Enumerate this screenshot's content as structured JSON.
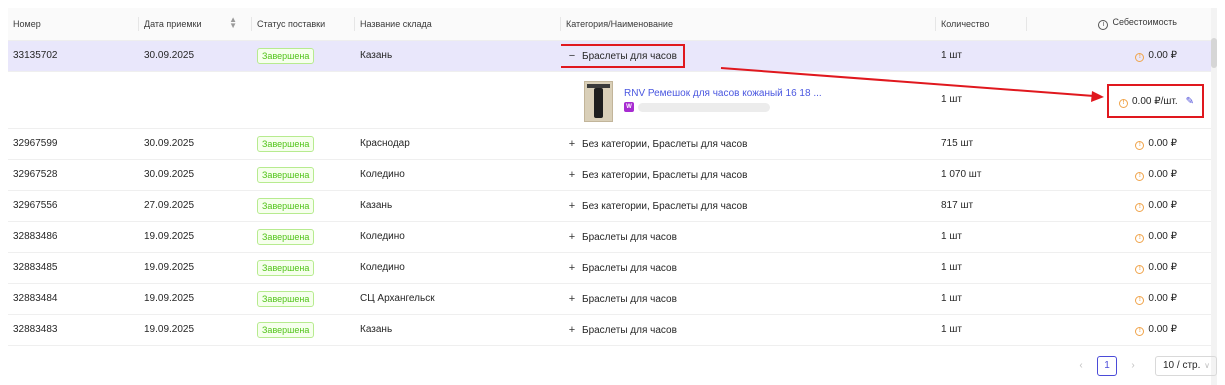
{
  "columns": {
    "number": "Номер",
    "date": "Дата приемки",
    "status": "Статус поставки",
    "warehouse": "Название склада",
    "category": "Категория/Наименование",
    "quantity": "Количество",
    "cost": "Себестоимость"
  },
  "rows": [
    {
      "number": "33135702",
      "date": "30.09.2025",
      "status": "Завершена",
      "warehouse": "Казань",
      "category": "Браслеты для часов",
      "quantity": "1 шт",
      "cost": "0.00 ₽",
      "expand": "−"
    },
    {
      "number": "32967599",
      "date": "30.09.2025",
      "status": "Завершена",
      "warehouse": "Краснодар",
      "category": "Без категории, Браслеты для часов",
      "quantity": "715 шт",
      "cost": "0.00 ₽",
      "expand": "+"
    },
    {
      "number": "32967528",
      "date": "30.09.2025",
      "status": "Завершена",
      "warehouse": "Коледино",
      "category": "Без категории, Браслеты для часов",
      "quantity": "1 070 шт",
      "cost": "0.00 ₽",
      "expand": "+"
    },
    {
      "number": "32967556",
      "date": "27.09.2025",
      "status": "Завершена",
      "warehouse": "Казань",
      "category": "Без категории, Браслеты для часов",
      "quantity": "817 шт",
      "cost": "0.00 ₽",
      "expand": "+"
    },
    {
      "number": "32883486",
      "date": "19.09.2025",
      "status": "Завершена",
      "warehouse": "Коледино",
      "category": "Браслеты для часов",
      "quantity": "1 шт",
      "cost": "0.00 ₽",
      "expand": "+"
    },
    {
      "number": "32883485",
      "date": "19.09.2025",
      "status": "Завершена",
      "warehouse": "Коледино",
      "category": "Браслеты для часов",
      "quantity": "1 шт",
      "cost": "0.00 ₽",
      "expand": "+"
    },
    {
      "number": "32883484",
      "date": "19.09.2025",
      "status": "Завершена",
      "warehouse": "СЦ Архангельск",
      "category": "Браслеты для часов",
      "quantity": "1 шт",
      "cost": "0.00 ₽",
      "expand": "+"
    },
    {
      "number": "32883483",
      "date": "19.09.2025",
      "status": "Завершена",
      "warehouse": "Казань",
      "category": "Браслеты для часов",
      "quantity": "1 шт",
      "cost": "0.00 ₽",
      "expand": "+"
    }
  ],
  "child_row": {
    "product_name": "RNV Ремешок для часов кожаный 16 18 ...",
    "quantity": "1 шт",
    "cost": "0.00 ₽/шт."
  },
  "pagination": {
    "prev": "‹",
    "current_page": "1",
    "next": "›",
    "page_size": "10 / стр."
  },
  "icons": {
    "sort": "sort-icon",
    "info": "info-icon",
    "warning": "warning-icon",
    "edit": "pencil-edit-icon",
    "marketplace": "wildberries-icon"
  },
  "colors": {
    "highlight_row": "#e9e7fb",
    "status_green": "#52c41a",
    "annotation_red": "#e0181e",
    "link_blue": "#4a57e0",
    "warning_orange": "#f0a44b"
  }
}
